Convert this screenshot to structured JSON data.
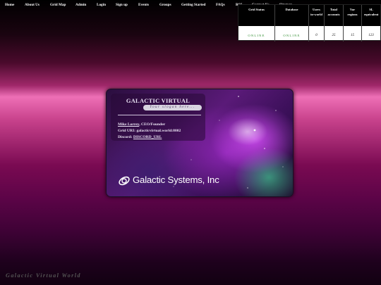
{
  "nav": {
    "items": [
      "Home",
      "About Us",
      "Grid Map",
      "Admin",
      "Login",
      "Sign up",
      "Events",
      "Groups",
      "Getting Started",
      "FAQs",
      "RSS",
      "Contact Us",
      "Sitemap"
    ]
  },
  "grid_status": {
    "headers": [
      "Grid Status",
      "Database",
      "Users in-world",
      "Total accounts",
      "Var regions",
      "SL equivalent"
    ],
    "values": [
      "ONLINE",
      "ONLINE",
      "0",
      "25",
      "15",
      "123"
    ],
    "online_color": "#2a8a2a"
  },
  "card": {
    "title": "GALACTIC VIRTUAL WORLD",
    "slogan": "Your slogan here...",
    "ceo_name": "Mike Lorrey",
    "ceo_role": ", CEO/Founder",
    "grid_uri_label": "Grid URI:",
    "grid_uri": "galacticvirtual.world:8002",
    "discord_label": "Discord:",
    "discord_link": "DISCORD_URL",
    "brand_name": "Galactic Systems, Inc"
  },
  "footer": {
    "brand": "Galactic Virtual World"
  }
}
